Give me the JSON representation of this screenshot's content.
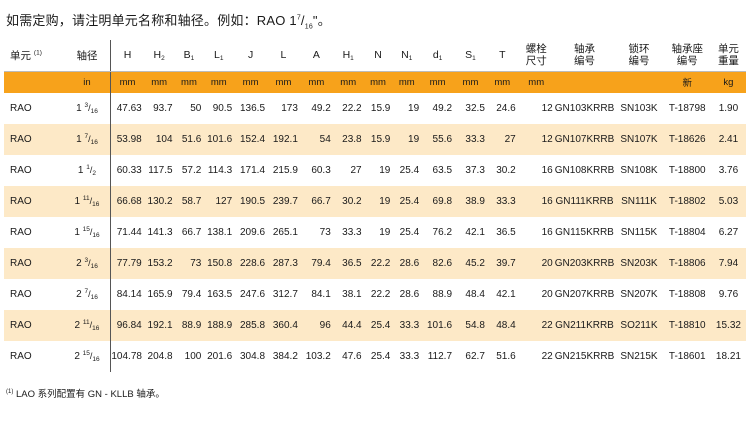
{
  "title": {
    "prefix": "如需定购，请注明单元名称和轴径。例如：RAO 1",
    "frac_num": "7",
    "frac_den": "16",
    "suffix": "\"。"
  },
  "headers": {
    "unit": "单元",
    "unit_note": "(1)",
    "axis": "轴径",
    "H": "H",
    "H2_base": "H",
    "H2_sub": "2",
    "B1_base": "B",
    "B1_sub": "1",
    "L1_base": "L",
    "L1_sub": "1",
    "J": "J",
    "L": "L",
    "A": "A",
    "H1_base": "H",
    "H1_sub": "1",
    "N": "N",
    "N1_base": "N",
    "N1_sub": "1",
    "d1_base": "d",
    "d1_sub": "1",
    "S1_base": "S",
    "S1_sub": "1",
    "T": "T",
    "bolt_l1": "螺栓",
    "bolt_l2": "尺寸",
    "bearing_l1": "轴承",
    "bearing_l2": "编号",
    "lock_l1": "锁环",
    "lock_l2": "编号",
    "housing_l1": "轴承座",
    "housing_l2": "编号",
    "weight_l1": "单元",
    "weight_l2": "重量"
  },
  "units": {
    "axis": "in",
    "mm": "mm",
    "housing": "新",
    "weight": "kg"
  },
  "rows": [
    {
      "unit": "RAO",
      "w": "1",
      "n": "3",
      "d": "16",
      "H": "47.63",
      "H2": "93.7",
      "B1": "50",
      "L1": "90.5",
      "J": "136.5",
      "L": "173",
      "A": "49.2",
      "H1": "22.2",
      "N": "15.9",
      "N1": "19",
      "d1": "49.2",
      "S1": "32.5",
      "T": "24.6",
      "bolt": "12",
      "bearing": "GN103KRRB",
      "lock": "SN103K",
      "housing": "T-18798",
      "weight": "1.90"
    },
    {
      "unit": "RAO",
      "w": "1",
      "n": "7",
      "d": "16",
      "H": "53.98",
      "H2": "104",
      "B1": "51.6",
      "L1": "101.6",
      "J": "152.4",
      "L": "192.1",
      "A": "54",
      "H1": "23.8",
      "N": "15.9",
      "N1": "19",
      "d1": "55.6",
      "S1": "33.3",
      "T": "27",
      "bolt": "12",
      "bearing": "GN107KRRB",
      "lock": "SN107K",
      "housing": "T-18626",
      "weight": "2.41"
    },
    {
      "unit": "RAO",
      "w": "1",
      "n": "1",
      "d": "2",
      "H": "60.33",
      "H2": "117.5",
      "B1": "57.2",
      "L1": "114.3",
      "J": "171.4",
      "L": "215.9",
      "A": "60.3",
      "H1": "27",
      "N": "19",
      "N1": "25.4",
      "d1": "63.5",
      "S1": "37.3",
      "T": "30.2",
      "bolt": "16",
      "bearing": "GN108KRRB",
      "lock": "SN108K",
      "housing": "T-18800",
      "weight": "3.76"
    },
    {
      "unit": "RAO",
      "w": "1",
      "n": "11",
      "d": "16",
      "H": "66.68",
      "H2": "130.2",
      "B1": "58.7",
      "L1": "127",
      "J": "190.5",
      "L": "239.7",
      "A": "66.7",
      "H1": "30.2",
      "N": "19",
      "N1": "25.4",
      "d1": "69.8",
      "S1": "38.9",
      "T": "33.3",
      "bolt": "16",
      "bearing": "GN111KRRB",
      "lock": "SN111K",
      "housing": "T-18802",
      "weight": "5.03"
    },
    {
      "unit": "RAO",
      "w": "1",
      "n": "15",
      "d": "16",
      "H": "71.44",
      "H2": "141.3",
      "B1": "66.7",
      "L1": "138.1",
      "J": "209.6",
      "L": "265.1",
      "A": "73",
      "H1": "33.3",
      "N": "19",
      "N1": "25.4",
      "d1": "76.2",
      "S1": "42.1",
      "T": "36.5",
      "bolt": "16",
      "bearing": "GN115KRRB",
      "lock": "SN115K",
      "housing": "T-18804",
      "weight": "6.27"
    },
    {
      "unit": "RAO",
      "w": "2",
      "n": "3",
      "d": "16",
      "H": "77.79",
      "H2": "153.2",
      "B1": "73",
      "L1": "150.8",
      "J": "228.6",
      "L": "287.3",
      "A": "79.4",
      "H1": "36.5",
      "N": "22.2",
      "N1": "28.6",
      "d1": "82.6",
      "S1": "45.2",
      "T": "39.7",
      "bolt": "20",
      "bearing": "GN203KRRB",
      "lock": "SN203K",
      "housing": "T-18806",
      "weight": "7.94"
    },
    {
      "unit": "RAO",
      "w": "2",
      "n": "7",
      "d": "16",
      "H": "84.14",
      "H2": "165.9",
      "B1": "79.4",
      "L1": "163.5",
      "J": "247.6",
      "L": "312.7",
      "A": "84.1",
      "H1": "38.1",
      "N": "22.2",
      "N1": "28.6",
      "d1": "88.9",
      "S1": "48.4",
      "T": "42.1",
      "bolt": "20",
      "bearing": "GN207KRRB",
      "lock": "SN207K",
      "housing": "T-18808",
      "weight": "9.76"
    },
    {
      "unit": "RAO",
      "w": "2",
      "n": "11",
      "d": "16",
      "H": "96.84",
      "H2": "192.1",
      "B1": "88.9",
      "L1": "188.9",
      "J": "285.8",
      "L": "360.4",
      "A": "96",
      "H1": "44.4",
      "N": "25.4",
      "N1": "33.3",
      "d1": "101.6",
      "S1": "54.8",
      "T": "48.4",
      "bolt": "22",
      "bearing": "GN211KRRB",
      "lock": "SO211K",
      "housing": "T-18810",
      "weight": "15.32"
    },
    {
      "unit": "RAO",
      "w": "2",
      "n": "15",
      "d": "16",
      "H": "104.78",
      "H2": "204.8",
      "B1": "100",
      "L1": "201.6",
      "J": "304.8",
      "L": "384.2",
      "A": "103.2",
      "H1": "47.6",
      "N": "25.4",
      "N1": "33.3",
      "d1": "112.7",
      "S1": "62.7",
      "T": "51.6",
      "bolt": "22",
      "bearing": "GN215KRRB",
      "lock": "SN215K",
      "housing": "T-18601",
      "weight": "18.21"
    }
  ],
  "footnote": {
    "mark": "(1)",
    "text": " LAO 系列配置有 GN - KLLB 轴承。"
  }
}
